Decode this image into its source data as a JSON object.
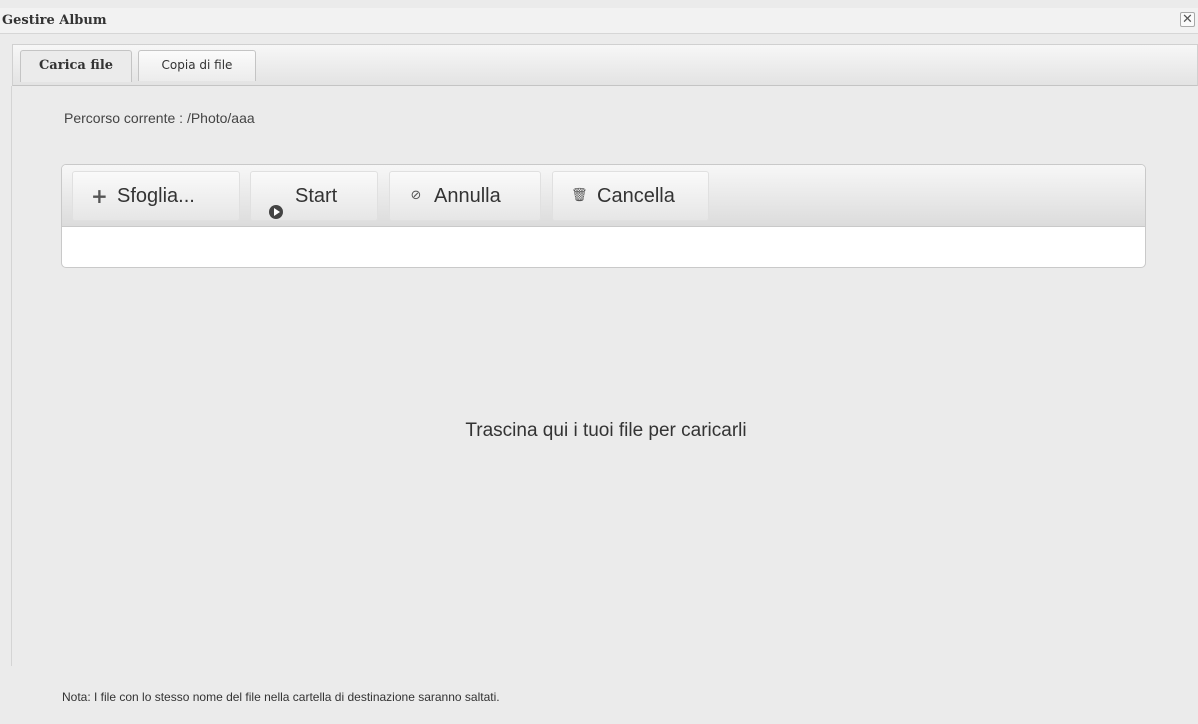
{
  "window": {
    "title": "Gestire Album",
    "close_glyph": "✕"
  },
  "tabs": [
    {
      "label": "Carica file",
      "active": true
    },
    {
      "label": "Copia di file",
      "active": false
    }
  ],
  "upload": {
    "current_path": "Percorso corrente : /Photo/aaa",
    "toolbar": {
      "browse_label": "Sfoglia...",
      "start_label": "Start",
      "cancel_label": "Annulla",
      "delete_label": "Cancella"
    },
    "icons": {
      "browse": "plus-icon",
      "start": "play-circle-icon",
      "cancel": "ban-icon",
      "delete": "trash-icon"
    },
    "dropzone_text": "Trascina qui i tuoi file per caricarli",
    "note": "Nota: I file con lo stesso nome del file nella cartella di destinazione saranno saltati."
  }
}
